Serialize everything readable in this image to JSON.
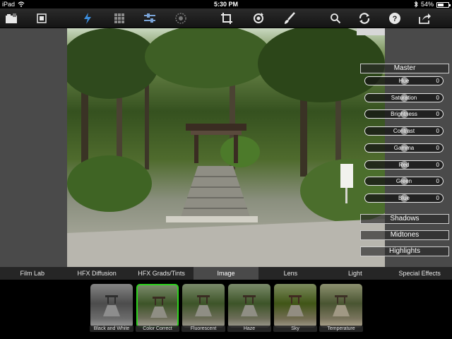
{
  "status_bar": {
    "device": "iPad",
    "time": "5:30 PM",
    "battery": "54%",
    "battery_level": 0.54
  },
  "toolbar": {
    "icons": [
      "photo-import-icon",
      "fullscreen-icon",
      "lightning-icon",
      "grid-icon",
      "sliders-icon",
      "target-icon",
      "crop-icon",
      "rotate-icon",
      "brush-icon",
      "search-icon",
      "refresh-icon",
      "help-icon",
      "share-icon"
    ],
    "help_label": "?"
  },
  "adjustments": {
    "master": "Master",
    "sliders": [
      {
        "label": "Hue",
        "value": "0",
        "level": 0.5
      },
      {
        "label": "Saturation",
        "value": "0",
        "level": 0.5
      },
      {
        "label": "Brightness",
        "value": "0",
        "level": 0.5
      },
      {
        "label": "Contrast",
        "value": "0",
        "level": 0.5
      },
      {
        "label": "Gamma",
        "value": "0",
        "level": 0.5
      },
      {
        "label": "Red",
        "value": "0",
        "level": 0.5
      },
      {
        "label": "Green",
        "value": "0",
        "level": 0.5
      },
      {
        "label": "Blue",
        "value": "0",
        "level": 0.5
      }
    ],
    "shadows": "Shadows",
    "midtones": "Midtones",
    "highlights": "Highlights"
  },
  "tabs": [
    {
      "label": "Film Lab",
      "active": false
    },
    {
      "label": "HFX Diffusion",
      "active": false
    },
    {
      "label": "HFX Grads/Tints",
      "active": false
    },
    {
      "label": "Image",
      "active": true
    },
    {
      "label": "Lens",
      "active": false
    },
    {
      "label": "Light",
      "active": false
    },
    {
      "label": "Special Effects",
      "active": false
    }
  ],
  "filters": [
    {
      "label": "Black and White",
      "selected": false
    },
    {
      "label": "Color Correct",
      "selected": true
    },
    {
      "label": "Fluorescent",
      "selected": false
    },
    {
      "label": "Haze",
      "selected": false
    },
    {
      "label": "Sky",
      "selected": false
    },
    {
      "label": "Temperature",
      "selected": false
    }
  ],
  "colors": {
    "selected_border": "#2ed11f",
    "active_tab": "#4a4a4a"
  }
}
